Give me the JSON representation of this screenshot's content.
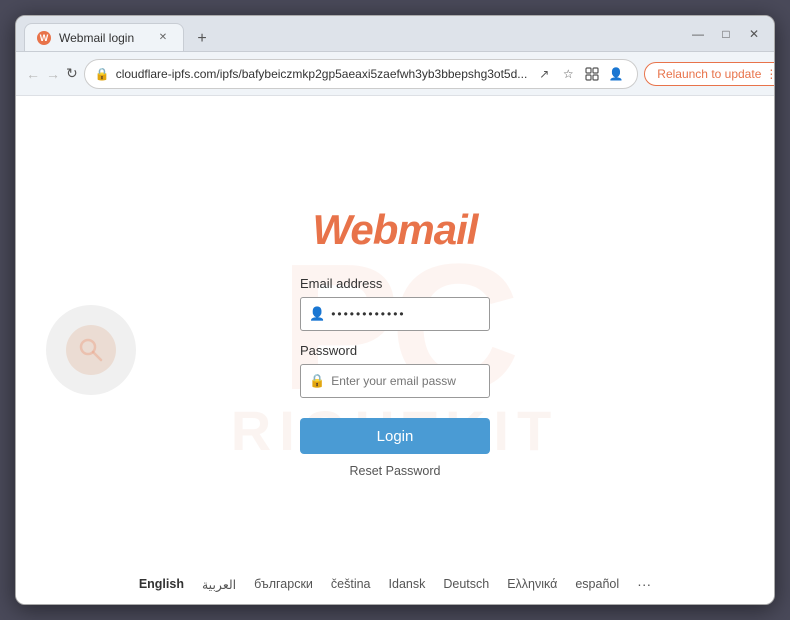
{
  "browser": {
    "tab_title": "Webmail login",
    "tab_favicon": "W",
    "url": "cloudflare-ipfs.com/ipfs/bafybeiczmkp2gp5aeaxi5zaefwh3yb3bbepshg3ot5d...",
    "relaunch_label": "Relaunch to update",
    "new_tab_symbol": "+",
    "back_symbol": "←",
    "forward_symbol": "→",
    "refresh_symbol": "↻",
    "close_symbol": "✕",
    "minimize_symbol": "—",
    "maximize_symbol": "□",
    "more_symbol": "⋮"
  },
  "page": {
    "logo_text": "Webmail",
    "email_label": "Email address",
    "email_placeholder": "••••••••••••",
    "password_label": "Password",
    "password_placeholder": "Enter your email passw",
    "login_button": "Login",
    "reset_link": "Reset Password",
    "watermark_pc": "PC",
    "watermark_text": "RightKit"
  },
  "languages": [
    {
      "code": "en",
      "label": "English",
      "active": true
    },
    {
      "code": "ar",
      "label": "العربية",
      "active": false
    },
    {
      "code": "bg",
      "label": "български",
      "active": false
    },
    {
      "code": "cs",
      "label": "čeština",
      "active": false
    },
    {
      "code": "id",
      "label": "Idansk",
      "active": false
    },
    {
      "code": "de",
      "label": "Deutsch",
      "active": false
    },
    {
      "code": "el",
      "label": "Ελληνικά",
      "active": false
    },
    {
      "code": "es",
      "label": "español",
      "active": false
    }
  ]
}
